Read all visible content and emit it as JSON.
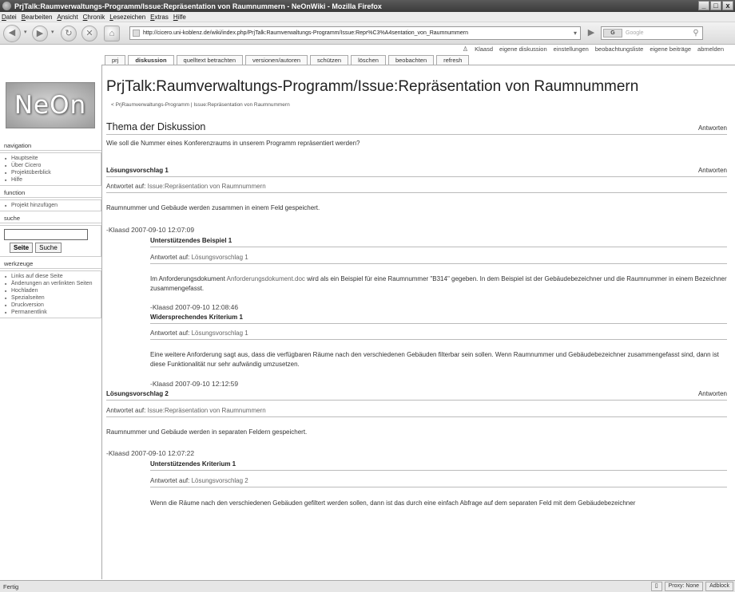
{
  "window": {
    "title": "PrjTalk:Raumverwaltungs-Programm/Issue:Repräsentation von Raumnummern - NeOnWiki - Mozilla Firefox",
    "minimize": "_",
    "maximize": "□",
    "close": "x"
  },
  "menu": [
    "Datei",
    "Bearbeiten",
    "Ansicht",
    "Chronik",
    "Lesezeichen",
    "Extras",
    "Hilfe"
  ],
  "browser": {
    "url": "http://cicero.uni-koblenz.de/wiki/index.php/PrjTalk:Raumverwaltungs-Programm/Issue:Repr%C3%A4sentation_von_Raumnummern",
    "search_engine": "G",
    "search_placeholder": "Google"
  },
  "personal": [
    "Klaasd",
    "eigene diskussion",
    "einstellungen",
    "beobachtungsliste",
    "eigene beiträge",
    "abmelden"
  ],
  "tabs": [
    "prj",
    "diskussion",
    "quelltext betrachten",
    "versionen/autoren",
    "schützen",
    "löschen",
    "beobachten",
    "refresh"
  ],
  "logo": "NeOn",
  "sidebar": {
    "navigation": {
      "title": "navigation",
      "items": [
        "Hauptseite",
        "Über Cicero",
        "Projektüberblick",
        "Hilfe"
      ]
    },
    "function": {
      "title": "function",
      "items": [
        "Projekt hinzufügen"
      ]
    },
    "search": {
      "title": "suche",
      "go": "Seite",
      "search": "Suche"
    },
    "tools": {
      "title": "werkzeuge",
      "items": [
        "Links auf diese Seite",
        "Änderungen an verlinkten Seiten",
        "Hochladen",
        "Spezialseiten",
        "Druckversion",
        "Permanentlink"
      ]
    }
  },
  "page": {
    "title": "PrjTalk:Raumverwaltungs-Programm/Issue:Repräsentation von Raumnummern",
    "breadcrumb": "< PrjRaumverwaltungs-Programm | Issue:Repräsentation von Raumnummern",
    "topic_heading": "Thema der Diskussion",
    "reply_label": "Antworten",
    "topic_text": "Wie soll die Nummer eines Konferenzraums in unserem Programm repräsentiert werden?",
    "answered_on": "Antwortet auf:",
    "proposal1": {
      "heading": "Lösungsvorschlag 1",
      "answers": "Issue:Repräsentation von Raumnummern",
      "text": "Raumnummer und Gebäude werden zusammen in einem Feld gespeichert.",
      "signature": "-Klaasd 2007-09-10 12:07:09",
      "example": {
        "heading": "Unterstützendes Beispiel 1",
        "answers": "Lösungsvorschlag 1",
        "text_before": "Im Anforderungsdokument ",
        "link": "Anforderungsdokument.doc",
        "text_after": " wird als ein Beispiel für eine Raumnummer \"B314\" gegeben. In dem Beispiel ist der Gebäudebezeichner und die Raumnummer in einem Bezeichner zusammengefasst.",
        "signature": "-Klaasd 2007-09-10 12:08:46"
      },
      "criterion": {
        "heading": "Widersprechendes Kriterium 1",
        "answers": "Lösungsvorschlag 1",
        "text": "Eine weitere Anforderung sagt aus, dass die verfügbaren Räume nach den verschiedenen Gebäuden filterbar sein sollen. Wenn Raumnummer und Gebäudebezeichner zusammengefasst sind, dann ist diese Funktionalität nur sehr aufwändig umzusetzen.",
        "signature": "-Klaasd 2007-09-10 12:12:59"
      }
    },
    "proposal2": {
      "heading": "Lösungsvorschlag 2",
      "answers": "Issue:Repräsentation von Raumnummern",
      "text": "Raumnummer und Gebäude werden in separaten Feldern gespeichert.",
      "signature": "-Klaasd 2007-09-10 12:07:22",
      "criterion": {
        "heading": "Unterstützendes Kriterium 1",
        "answers": "Lösungsvorschlag 2",
        "text": "Wenn die Räume nach den verschiedenen Gebäuden gefiltert werden sollen, dann ist das durch eine einfach Abfrage auf dem separaten Feld mit dem Gebäudebezeichner"
      }
    }
  },
  "status": {
    "left": "Fertig",
    "proxy": "Proxy: None",
    "adblock": "Adblock"
  }
}
